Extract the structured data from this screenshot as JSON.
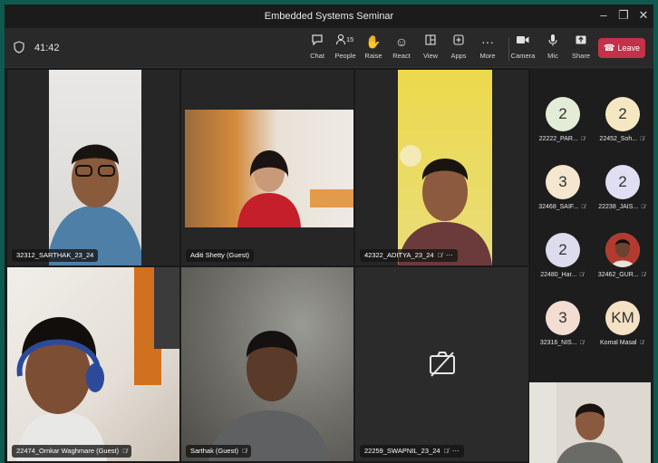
{
  "window": {
    "title": "Embedded Systems Seminar",
    "controls": [
      "–",
      "❐",
      "✕"
    ]
  },
  "toolbar": {
    "timer": "41:42",
    "people_count": "15",
    "buttons": [
      {
        "label": "Chat",
        "icon": "chat-icon"
      },
      {
        "label": "People",
        "icon": "people-icon"
      },
      {
        "label": "Raise",
        "icon": "raise-hand-icon"
      },
      {
        "label": "React",
        "icon": "react-icon"
      },
      {
        "label": "View",
        "icon": "view-icon"
      },
      {
        "label": "Apps",
        "icon": "apps-icon"
      },
      {
        "label": "More",
        "icon": "more-icon"
      },
      {
        "label": "Camera",
        "icon": "camera-icon"
      },
      {
        "label": "Mic",
        "icon": "mic-icon"
      },
      {
        "label": "Share",
        "icon": "share-icon"
      }
    ],
    "leave_label": "Leave"
  },
  "tiles": [
    {
      "name": "32312_SARTHAK_23_24",
      "muted": false
    },
    {
      "name": "Aditi Shetty (Guest)",
      "muted": false
    },
    {
      "name": "42322_ADITYA_23_24",
      "muted": true,
      "more": "···"
    },
    {
      "name": "22474_Omkar Waghmare (Guest)",
      "muted": true
    },
    {
      "name": "Sarthak (Guest)",
      "muted": true
    },
    {
      "name": "22259_SWAPNIL_23_24",
      "muted": true,
      "more": "···",
      "camera_off": true
    }
  ],
  "participants": [
    {
      "initials": "2",
      "name": "22222_PAR...",
      "color": "#e3ecd6"
    },
    {
      "initials": "2",
      "name": "22452_Soh...",
      "color": "#f4e7c2"
    },
    {
      "initials": "3",
      "name": "32468_SAIF...",
      "color": "#f5e6d0"
    },
    {
      "initials": "2",
      "name": "22238_JAIS...",
      "color": "#e0def2"
    },
    {
      "initials": "2",
      "name": "22480_Har...",
      "color": "#dcdcec"
    },
    {
      "initials": "",
      "name": "32462_GUR...",
      "color": "#c9b39a",
      "photo": true
    },
    {
      "initials": "3",
      "name": "32316_NIS...",
      "color": "#f3dcd2"
    },
    {
      "initials": "KM",
      "name": "Komal Masal",
      "color": "#f5e1c4"
    }
  ]
}
